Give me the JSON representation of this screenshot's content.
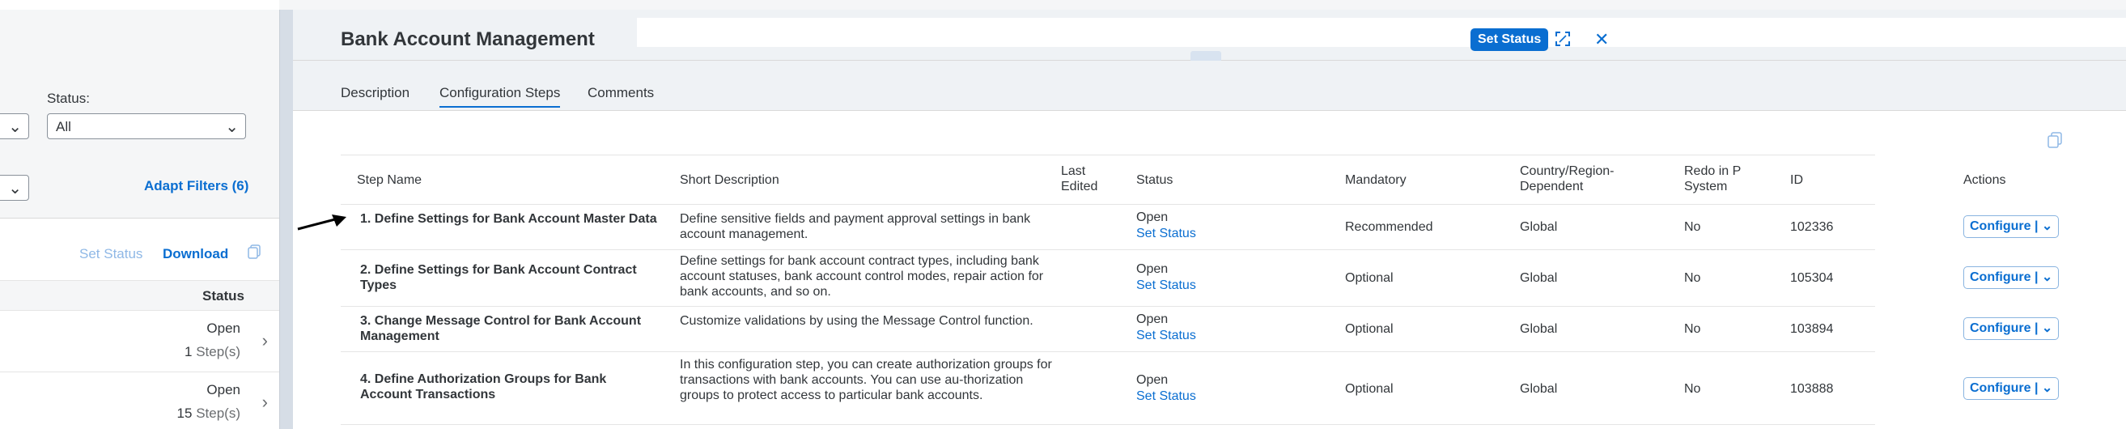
{
  "left": {
    "status_label": "Status:",
    "status_value": "All",
    "adapt_filters": "Adapt Filters (6)",
    "toolbar": {
      "set_status": "Set Status",
      "download": "Download"
    },
    "column_status": "Status",
    "items": [
      {
        "status": "Open",
        "steps_count": "1",
        "steps_unit": "Step(s)"
      },
      {
        "status": "Open",
        "steps_count": "15",
        "steps_unit": "Step(s)"
      }
    ]
  },
  "detail": {
    "title": "Bank Account Management",
    "set_status_button": "Set Status",
    "tabs": [
      "Description",
      "Configuration Steps",
      "Comments"
    ],
    "columns": [
      "Step Name",
      "Short Description",
      "Last Edited",
      "Status",
      "Mandatory",
      "Country/Region-Dependent",
      "Redo in P System",
      "ID",
      "Actions"
    ],
    "rows": [
      {
        "step": "1. Define Settings for Bank Account Master Data",
        "description": "Define sensitive fields and payment approval settings in bank account management.",
        "status": "Open",
        "status_link": "Set Status",
        "mandatory": "Recommended",
        "country": "Global",
        "redo": "No",
        "id": "102336",
        "action": "Configure |"
      },
      {
        "step": "2. Define Settings for Bank Account Contract Types",
        "description": "Define settings for bank account contract types, including bank account statuses, bank account control modes, repair action for bank accounts, and so on.",
        "status": "Open",
        "status_link": "Set Status",
        "mandatory": "Optional",
        "country": "Global",
        "redo": "No",
        "id": "105304",
        "action": "Configure |"
      },
      {
        "step": "3. Change Message Control for Bank Account Management",
        "description": "Customize validations by using the Message Control function.",
        "status": "Open",
        "status_link": "Set Status",
        "mandatory": "Optional",
        "country": "Global",
        "redo": "No",
        "id": "103894",
        "action": "Configure |"
      },
      {
        "step": "4. Define Authorization Groups for Bank Account Transactions",
        "description": "In this configuration step, you can create authorization groups for transactions with bank accounts. You can use au-thorization groups to protect access to particular bank accounts.",
        "status": "Open",
        "status_link": "Set Status",
        "mandatory": "Optional",
        "country": "Global",
        "redo": "No",
        "id": "103888",
        "action": "Configure |"
      }
    ]
  },
  "colors": {
    "accent": "#0a6ed1",
    "text": "#32363a",
    "background": "#f5f6f7"
  }
}
